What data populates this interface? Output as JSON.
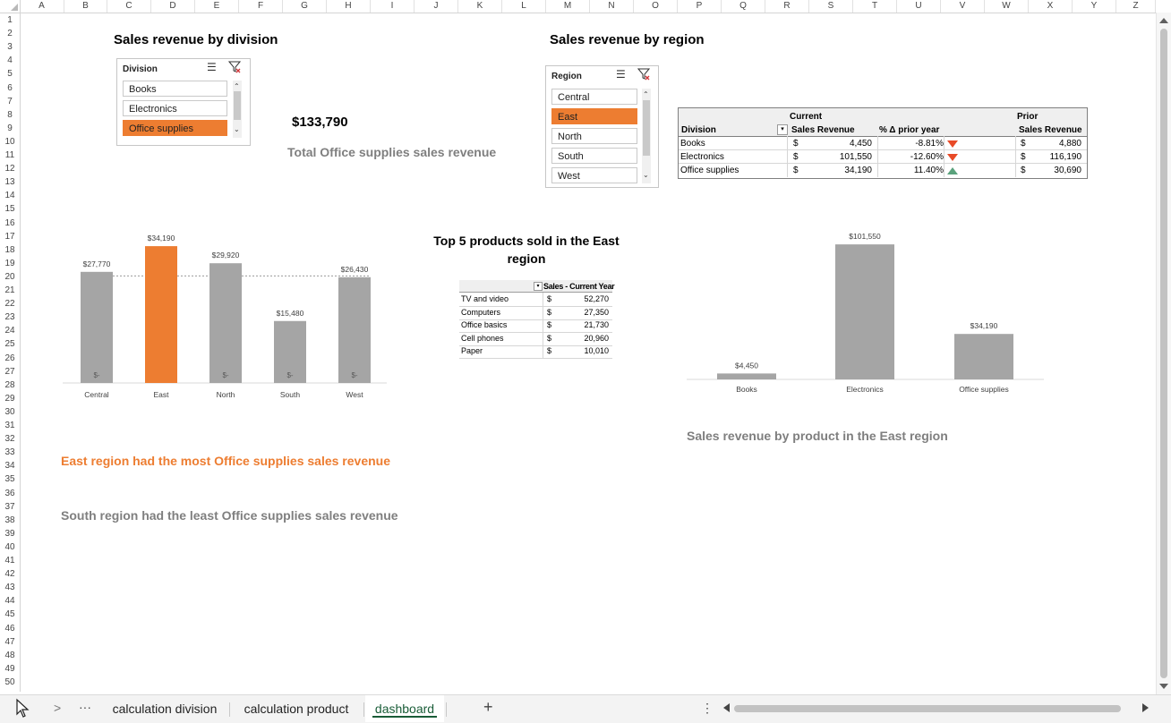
{
  "columns": [
    "A",
    "B",
    "C",
    "D",
    "E",
    "F",
    "G",
    "H",
    "I",
    "J",
    "K",
    "L",
    "M",
    "N",
    "O",
    "P",
    "Q",
    "R",
    "S",
    "T",
    "U",
    "V",
    "W",
    "X",
    "Y",
    "Z"
  ],
  "rows": [
    "1",
    "2",
    "3",
    "4",
    "5",
    "6",
    "7",
    "8",
    "9",
    "10",
    "11",
    "12",
    "13",
    "14",
    "15",
    "16",
    "17",
    "18",
    "19",
    "20",
    "21",
    "22",
    "23",
    "24",
    "25",
    "26",
    "27",
    "28",
    "29",
    "30",
    "31",
    "32",
    "33",
    "34",
    "35",
    "36",
    "37",
    "38",
    "39",
    "40",
    "41",
    "42",
    "43",
    "44",
    "45",
    "46",
    "47",
    "48",
    "49",
    "50"
  ],
  "titles": {
    "division": "Sales revenue by division",
    "region": "Sales revenue by region",
    "top5": "Top 5 products sold in the East region",
    "product_chart": "Sales revenue by product in the East region"
  },
  "division_slicer": {
    "header": "Division",
    "items": [
      {
        "label": "Books",
        "selected": false
      },
      {
        "label": "Electronics",
        "selected": false
      },
      {
        "label": "Office supplies",
        "selected": true
      }
    ]
  },
  "region_slicer": {
    "header": "Region",
    "items": [
      {
        "label": "Central",
        "selected": false
      },
      {
        "label": "East",
        "selected": true
      },
      {
        "label": "North",
        "selected": false
      },
      {
        "label": "South",
        "selected": false
      },
      {
        "label": "West",
        "selected": false
      }
    ]
  },
  "kpi": {
    "value": "$133,790",
    "label": "Total Office supplies sales revenue"
  },
  "division_table": {
    "group_current": "Current",
    "group_prior": "Prior",
    "col_division": "Division",
    "col_sales_revenue": "Sales Revenue",
    "col_pct": "% Δ prior year",
    "col_prior_sales": "Sales Revenue",
    "currency": "$",
    "rows": [
      {
        "division": "Books",
        "current": "4,450",
        "pct": "-8.81%",
        "trend": "down",
        "prior": "4,880"
      },
      {
        "division": "Electronics",
        "current": "101,550",
        "pct": "-12.60%",
        "trend": "down",
        "prior": "116,190"
      },
      {
        "division": "Office supplies",
        "current": "34,190",
        "pct": "11.40%",
        "trend": "up",
        "prior": "30,690"
      }
    ]
  },
  "insights": {
    "most": "East region had the most Office supplies sales revenue",
    "least": "South region had the least Office supplies sales revenue"
  },
  "top5_table": {
    "header": "Sales - Current Year",
    "currency": "$",
    "rows": [
      {
        "product": "TV and video",
        "value": "52,270"
      },
      {
        "product": "Computers",
        "value": "27,350"
      },
      {
        "product": "Office basics",
        "value": "21,730"
      },
      {
        "product": "Cell phones",
        "value": "20,960"
      },
      {
        "product": "Paper",
        "value": "10,010"
      }
    ]
  },
  "colors": {
    "accent": "#ed7d31",
    "bar_grey": "#a5a5a5",
    "heading_grey": "#7f7f7f",
    "sheet_tab_active": "#185c37",
    "trend_down": "#e84a27",
    "trend_up": "#5aa27c"
  },
  "sheet_tabs": [
    {
      "label": "calculation division",
      "active": false
    },
    {
      "label": "calculation product",
      "active": false
    },
    {
      "label": "dashboard",
      "active": true
    }
  ],
  "tabbar_icons": {
    "prev": "◁",
    "next": ">",
    "more": "···",
    "add": "+",
    "menu": "⋮"
  },
  "chart_data": [
    {
      "type": "bar",
      "categories": [
        "Central",
        "East",
        "North",
        "South",
        "West"
      ],
      "values": [
        27770,
        34190,
        29920,
        15480,
        26430
      ],
      "data_labels": [
        "$27,770",
        "$34,190",
        "$29,920",
        "$15,480",
        "$26,430"
      ],
      "base_labels": [
        "$-",
        "",
        "$-",
        "$-",
        "$-"
      ],
      "highlight": "East",
      "average_line": 26758,
      "ylim": [
        0,
        36000
      ]
    },
    {
      "type": "bar",
      "categories": [
        "Books",
        "Electronics",
        "Office supplies"
      ],
      "values": [
        4450,
        101550,
        34190
      ],
      "data_labels": [
        "$4,450",
        "$101,550",
        "$34,190"
      ],
      "ylim": [
        0,
        105000
      ]
    }
  ]
}
